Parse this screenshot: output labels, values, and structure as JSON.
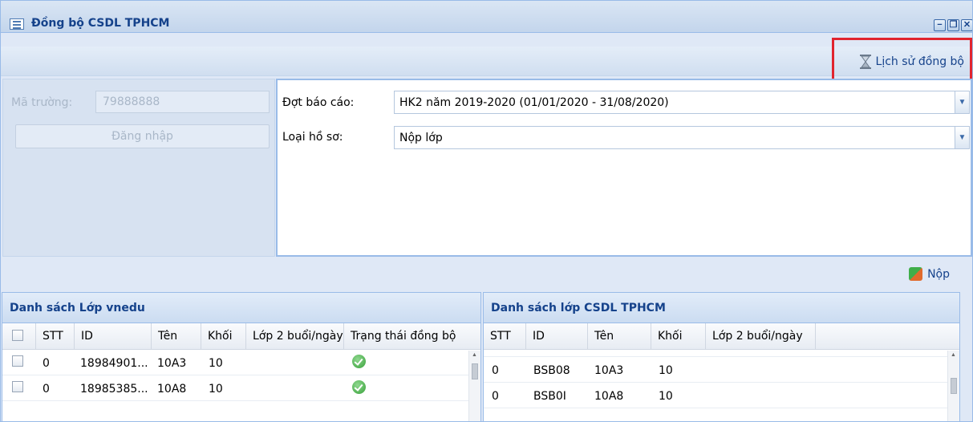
{
  "window": {
    "title": "Đồng bộ CSDL TPHCM",
    "controls": {
      "minimize": "−",
      "restore": "❐",
      "close": "✕"
    }
  },
  "toolbar": {
    "history_label": "Lịch sử đồng bộ",
    "history_icon": "hourglass-icon"
  },
  "login": {
    "ma_truong_label": "Mã trường:",
    "ma_truong_value": "79888888",
    "login_button": "Đăng nhập"
  },
  "form": {
    "dot_bao_cao_label": "Đợt báo cáo:",
    "dot_bao_cao_value": "HK2 năm 2019-2020 (01/01/2020 - 31/08/2020)",
    "loai_ho_so_label": "Loại hồ sơ:",
    "loai_ho_so_value": "Nộp lớp"
  },
  "submit": {
    "label": "Nộp",
    "icon": "sync-icon"
  },
  "grid_left": {
    "title": "Danh sách Lớp vnedu",
    "columns": [
      "STT",
      "ID",
      "Tên",
      "Khối",
      "Lớp 2 buổi/ngày",
      "Trạng thái đồng bộ"
    ],
    "rows": [
      {
        "stt": "0",
        "id": "18984901...",
        "ten": "10A3",
        "khoi": "10",
        "lop2": "",
        "status": "synced"
      },
      {
        "stt": "0",
        "id": "18985385...",
        "ten": "10A8",
        "khoi": "10",
        "lop2": "",
        "status": "synced"
      }
    ]
  },
  "grid_right": {
    "title": "Danh sách lớp CSDL TPHCM",
    "columns": [
      "STT",
      "ID",
      "Tên",
      "Khối",
      "Lớp 2 buổi/ngày"
    ],
    "rows": [
      {
        "stt": "0",
        "id": "BSB08",
        "ten": "10A3",
        "khoi": "10",
        "lop2": ""
      },
      {
        "stt": "0",
        "id": "BSB0I",
        "ten": "10A8",
        "khoi": "10",
        "lop2": ""
      }
    ]
  },
  "colors": {
    "accent": "#15428b",
    "highlight": "#e1242e",
    "border": "#99bbe8"
  }
}
